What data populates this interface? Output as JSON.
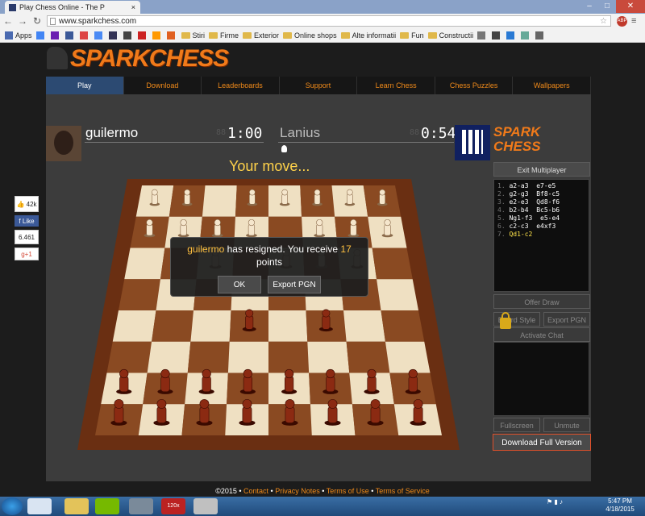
{
  "browser": {
    "tab_title": "Play Chess Online - The P",
    "tab_close": "×",
    "url": "www.sparkchess.com",
    "window_controls": [
      "–",
      "□",
      "✕"
    ],
    "abp": "ABP",
    "bookmarks": [
      {
        "label": "Apps",
        "icon": "apps-icon"
      },
      {
        "label": "",
        "icon": "google-icon"
      },
      {
        "label": "",
        "icon": "yahoo-icon"
      },
      {
        "label": "",
        "icon": "facebook-icon"
      },
      {
        "label": "",
        "icon": "mail-icon"
      },
      {
        "label": "",
        "icon": "translate-icon"
      },
      {
        "label": "",
        "icon": "news-icon"
      },
      {
        "label": "",
        "icon": "rl-icon"
      },
      {
        "label": "",
        "icon": "red-icon"
      },
      {
        "label": "",
        "icon": "shop-icon"
      },
      {
        "label": "",
        "icon": "tag-icon"
      },
      {
        "label": "Stiri",
        "icon": "folder-icon"
      },
      {
        "label": "Firme",
        "icon": "folder-icon"
      },
      {
        "label": "Exterior",
        "icon": "folder-icon"
      },
      {
        "label": "Online shops",
        "icon": "folder-icon"
      },
      {
        "label": "Alte informatii",
        "icon": "folder-icon"
      },
      {
        "label": "Fun",
        "icon": "folder-icon"
      },
      {
        "label": "Constructii",
        "icon": "folder-icon"
      },
      {
        "label": "",
        "icon": "doc-icon"
      },
      {
        "label": "",
        "icon": "rl-icon"
      },
      {
        "label": "",
        "icon": "globe-icon"
      },
      {
        "label": "",
        "icon": "globe2-icon"
      },
      {
        "label": "",
        "icon": "circle-icon"
      }
    ]
  },
  "site": {
    "logo": "SPARKCHESS",
    "nav": [
      "Play",
      "Download",
      "Leaderboards",
      "Support",
      "Learn Chess",
      "Chess Puzzles",
      "Wallpapers"
    ],
    "nav_active": 0
  },
  "game": {
    "player1": {
      "name": "guilermo",
      "clock": "1:00",
      "clock_dim": "88"
    },
    "player2": {
      "name": "Lanius",
      "clock": "0:54",
      "clock_dim": "88"
    },
    "spark_logo_top": "SPARK",
    "spark_logo_bottom": "CHESS",
    "status": "Your move...",
    "dialog": {
      "name": "guilermo",
      "text1": " has resigned. You receive ",
      "points": "17",
      "text2": "points",
      "ok": "OK",
      "export": "Export PGN"
    }
  },
  "side": {
    "exit": "Exit Multiplayer",
    "moves": [
      {
        "n": "1.",
        "w": "a2-a3",
        "b": "e7-e5"
      },
      {
        "n": "2.",
        "w": "g2-g3",
        "b": "Bf8-c5"
      },
      {
        "n": "3.",
        "w": "e2-e3",
        "b": "Qd8-f6"
      },
      {
        "n": "4.",
        "w": "b2-b4",
        "b": "Bc5-b6"
      },
      {
        "n": "5.",
        "w": "Ng1-f3",
        "b": "e5-e4"
      },
      {
        "n": "6.",
        "w": "c2-c3",
        "b": "e4xf3"
      },
      {
        "n": "7.",
        "w": "Qd1-c2",
        "b": ""
      }
    ],
    "offer_draw": "Offer Draw",
    "board_style": "Board Style",
    "export_pgn": "Export PGN",
    "activate_chat": "Activate Chat",
    "fullscreen": "Fullscreen",
    "unmute": "Unmute",
    "download_full": "Download Full Version"
  },
  "social": {
    "likes": "42k",
    "like": "Like",
    "count": "6.461",
    "gplus": "+1"
  },
  "footer": {
    "copy": "©2015 • ",
    "links": [
      "Contact",
      "Privacy Notes",
      "Terms of Use",
      "Terms of Service"
    ]
  },
  "taskbar": {
    "time": "5:47 PM",
    "date": "4/18/2015",
    "app_badge": "120x"
  }
}
